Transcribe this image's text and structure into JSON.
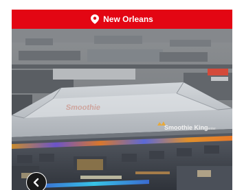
{
  "location": {
    "city": "New Orleans",
    "pin_icon": "location-pin-icon"
  },
  "photo": {
    "signage": "Smoothie King",
    "signage_sub": "center"
  },
  "navigation": {
    "back_icon": "chevron-left-icon"
  },
  "colors": {
    "banner": "#e30613",
    "banner_text": "#ffffff",
    "button_bg": "#1a1a1a"
  }
}
